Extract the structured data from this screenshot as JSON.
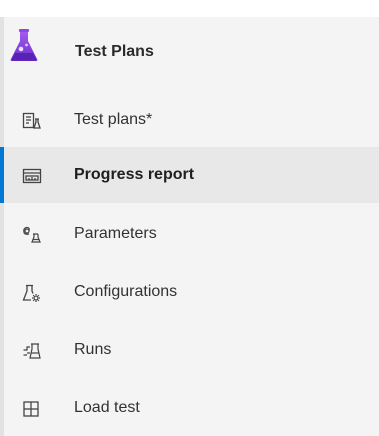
{
  "header": {
    "title": "Test Plans",
    "icon": "beaker-icon",
    "accent": "#773adc"
  },
  "nav": {
    "selected_index": 1,
    "selection_color": "#0078d4",
    "items": [
      {
        "label": "Test plans*",
        "icon": "test-plans-icon"
      },
      {
        "label": "Progress report",
        "icon": "progress-report-icon"
      },
      {
        "label": "Parameters",
        "icon": "parameters-icon"
      },
      {
        "label": "Configurations",
        "icon": "configurations-icon"
      },
      {
        "label": "Runs",
        "icon": "runs-icon"
      },
      {
        "label": "Load test",
        "icon": "load-test-icon"
      }
    ]
  }
}
